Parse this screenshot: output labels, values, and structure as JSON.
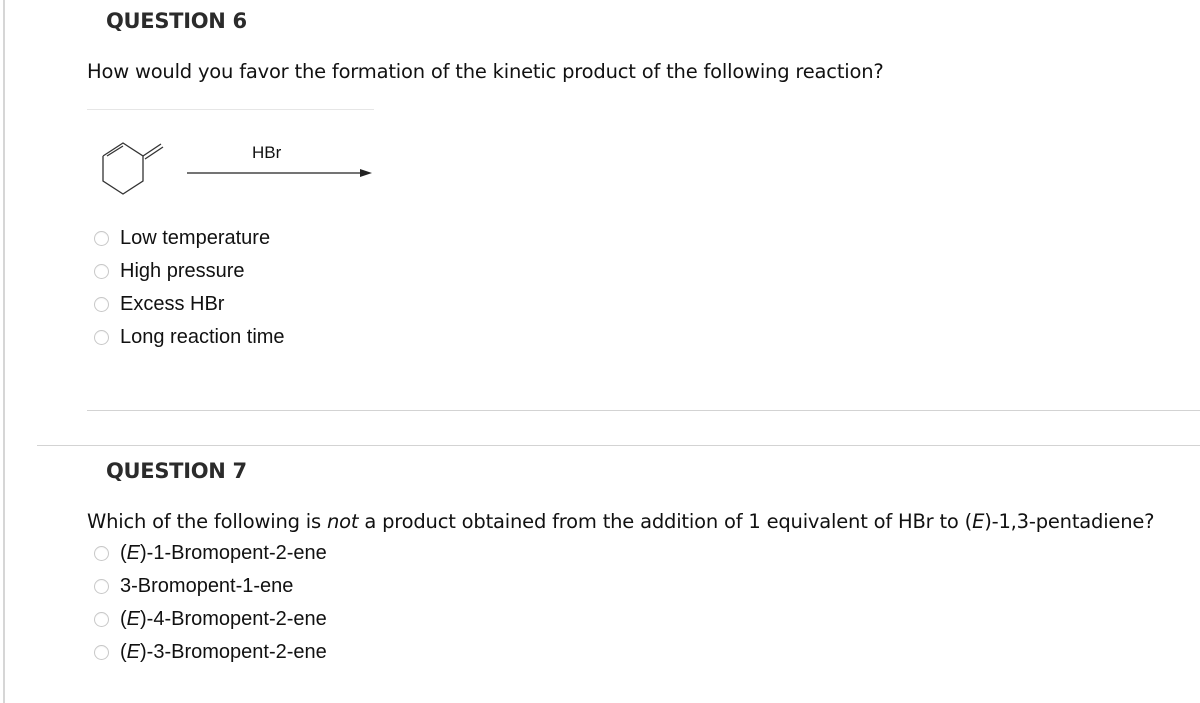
{
  "questions": [
    {
      "title": "QUESTION 6",
      "prompt": "How would you favor the formation of the kinetic product of the following reaction?",
      "reaction": {
        "reactant": "3-methylenecyclohexene (structure)",
        "reagent": "HBr",
        "arrow": "right-arrow-icon"
      },
      "options": [
        {
          "label": "Low temperature",
          "selected": false
        },
        {
          "label": "High pressure",
          "selected": false
        },
        {
          "label": "Excess HBr",
          "selected": false
        },
        {
          "label": "Long reaction time",
          "selected": false
        }
      ]
    },
    {
      "title": "QUESTION 7",
      "prompt_before": "Which of the following is ",
      "prompt_emph": "not",
      "prompt_after": " a product obtained from the addition of 1 equivalent of HBr to (",
      "prompt_emph2": "E",
      "prompt_end": ")-1,3-pentadiene?",
      "options": [
        {
          "pre": "(",
          "emph": "E",
          "post": ")-1-Bromopent-2-ene",
          "selected": false
        },
        {
          "pre": "",
          "emph": "",
          "post": "3-Bromopent-1-ene",
          "selected": false
        },
        {
          "pre": "(",
          "emph": "E",
          "post": ")-4-Bromopent-2-ene",
          "selected": false
        },
        {
          "pre": "(",
          "emph": "E",
          "post": ")-3-Bromopent-2-ene",
          "selected": false
        }
      ]
    }
  ]
}
